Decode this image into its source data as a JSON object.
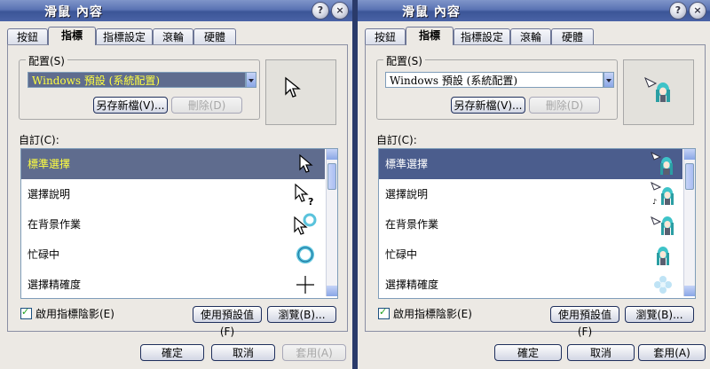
{
  "dialogs": [
    {
      "title": "滑鼠 內容",
      "help_glyph": "?",
      "close_glyph": "×",
      "tabs": [
        "按鈕",
        "指標",
        "指標設定",
        "滾輪",
        "硬體"
      ],
      "active_tab": "指標",
      "scheme_group_label": "配置(S)",
      "scheme_value": "Windows 預設 (系統配置)",
      "save_as_label": "另存新檔(V)...",
      "delete_label": "刪除(D)",
      "customize_label": "自訂(C):",
      "items": [
        {
          "label": "標準選擇",
          "icon": "arrow-cursor-icon"
        },
        {
          "label": "選擇說明",
          "icon": "help-cursor-icon"
        },
        {
          "label": "在背景作業",
          "icon": "working-in-background-cursor-icon"
        },
        {
          "label": "忙碌中",
          "icon": "busy-cursor-icon"
        },
        {
          "label": "選擇精確度",
          "icon": "precision-select-cursor-icon"
        }
      ],
      "shadow_label": "啟用指標陰影(E)",
      "use_default_label": "使用預設值(F)",
      "browse_label": "瀏覽(B)...",
      "ok_label": "確定",
      "cancel_label": "取消",
      "apply_label": "套用(A)"
    },
    {
      "title": "滑鼠 內容",
      "help_glyph": "?",
      "close_glyph": "×",
      "tabs": [
        "按鈕",
        "指標",
        "指標設定",
        "滾輪",
        "硬體"
      ],
      "active_tab": "指標",
      "scheme_group_label": "配置(S)",
      "scheme_value": "Windows 預設 (系統配置)",
      "save_as_label": "另存新檔(V)...",
      "delete_label": "刪除(D)",
      "customize_label": "自訂(C):",
      "items": [
        {
          "label": "標準選擇",
          "icon": "miku-cursor-icon"
        },
        {
          "label": "選擇說明",
          "icon": "miku-help-cursor-icon"
        },
        {
          "label": "在背景作業",
          "icon": "miku-working-cursor-icon"
        },
        {
          "label": "忙碌中",
          "icon": "miku-busy-cursor-icon"
        },
        {
          "label": "選擇精確度",
          "icon": "sparkle-precision-cursor-icon"
        }
      ],
      "shadow_label": "啟用指標陰影(E)",
      "use_default_label": "使用預設值(F)",
      "browse_label": "瀏覽(B)...",
      "ok_label": "確定",
      "cancel_label": "取消",
      "apply_label": "套用(A)"
    }
  ],
  "colors": {
    "selected_left": "#5f6c8e",
    "selected_right": "#4b5d8d",
    "selected_text_left": "#ffff40",
    "miku_hair": "#3ec3c8"
  }
}
